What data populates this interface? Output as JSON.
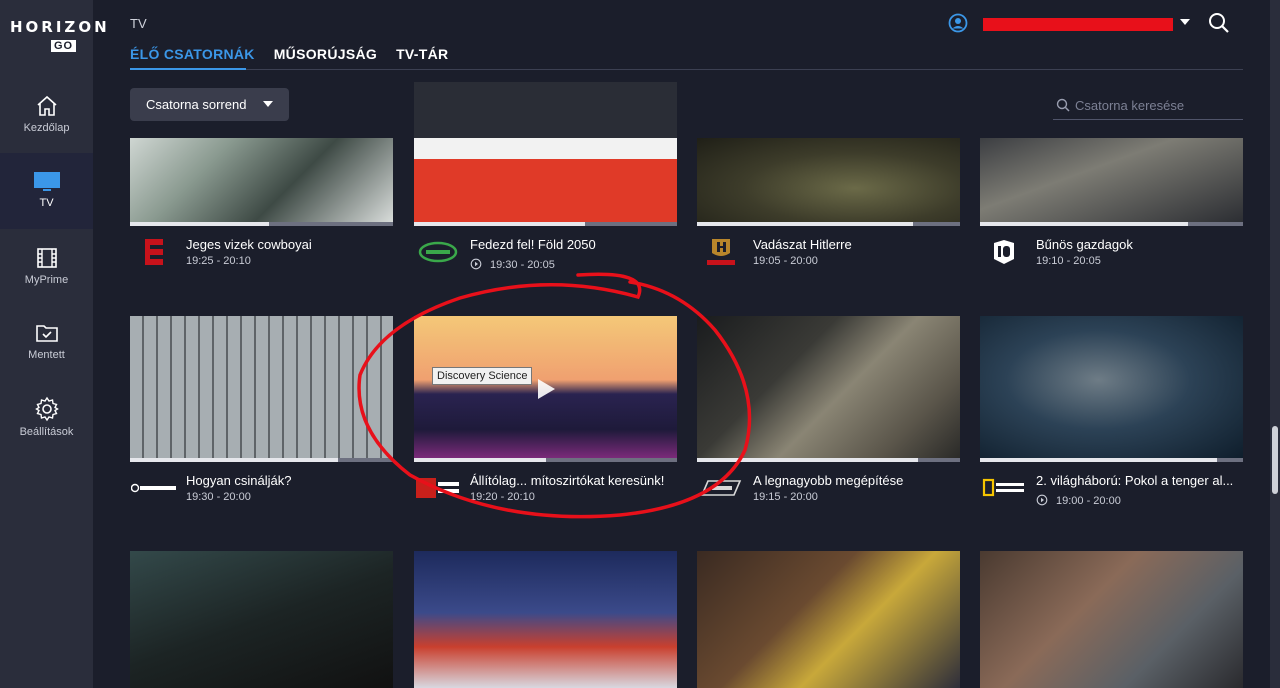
{
  "brand": {
    "top": "HORIZON",
    "bottom": "GO"
  },
  "sidebar": {
    "items": [
      {
        "label": "Kezdőlap",
        "icon": "home-icon",
        "active": false
      },
      {
        "label": "TV",
        "icon": "tv-icon",
        "active": true
      },
      {
        "label": "MyPrime",
        "icon": "film-icon",
        "active": false
      },
      {
        "label": "Mentett",
        "icon": "folder-check-icon",
        "active": false
      },
      {
        "label": "Beállítások",
        "icon": "gear-icon",
        "active": false
      }
    ]
  },
  "header": {
    "title": "TV",
    "tabs": [
      "ÉLŐ CSATORNÁK",
      "MŰSORÚJSÁG",
      "TV-TÁR"
    ],
    "active_tab": 0
  },
  "toolbar": {
    "sort_label": "Csatorna sorrend",
    "search_placeholder": "Csatorna keresése"
  },
  "tooltip": "Discovery Science",
  "colors": {
    "accent": "#3b97e8",
    "annotation": "#e8101a",
    "background": "#1b1e2b",
    "sidebar": "#2a2d3b"
  },
  "rows": [
    [
      {
        "channel": "E",
        "channel_icon": "eurosport-logo-icon",
        "title": "Jeges vizek cowboyai",
        "time": "19:25 - 20:10",
        "replay": false,
        "progress": 0.53
      },
      {
        "channel": "dare",
        "channel_icon": "dare-logo-icon",
        "title": "Fedezd fel! Föld 2050",
        "time": "19:30 - 20:05",
        "replay": true,
        "progress": 0.65
      },
      {
        "channel": "H HISTORY",
        "channel_icon": "history-logo-icon",
        "title": "Vadászat Hitlerre",
        "time": "19:05 - 20:00",
        "replay": false,
        "progress": 0.82
      },
      {
        "channel": "ID",
        "channel_icon": "id-logo-icon",
        "title": "Bűnös gazdagok",
        "time": "19:10 - 20:05",
        "replay": false,
        "progress": 0.79
      }
    ],
    [
      {
        "channel": "discovery",
        "channel_icon": "discovery-logo-icon",
        "title": "Hogyan csinálják?",
        "time": "19:30 - 20:00",
        "replay": false,
        "progress": 0.79
      },
      {
        "channel": "SCI DISCOVERY SCIENCE",
        "channel_icon": "discovery-science-logo-icon",
        "title": "Állítólag... mítoszirtókat keresünk!",
        "time": "19:20 - 20:10",
        "replay": false,
        "progress": 0.5
      },
      {
        "channel": "DTX",
        "channel_icon": "dtx-logo-icon",
        "title": "A legnagyobb megépítése",
        "time": "19:15 - 20:00",
        "replay": false,
        "progress": 0.84
      },
      {
        "channel": "NATIONAL GEOGRAPHIC",
        "channel_icon": "natgeo-logo-icon",
        "title": "2. világháború: Pokol a tenger al...",
        "time": "19:00 - 20:00",
        "replay": true,
        "progress": 0.9
      }
    ]
  ]
}
